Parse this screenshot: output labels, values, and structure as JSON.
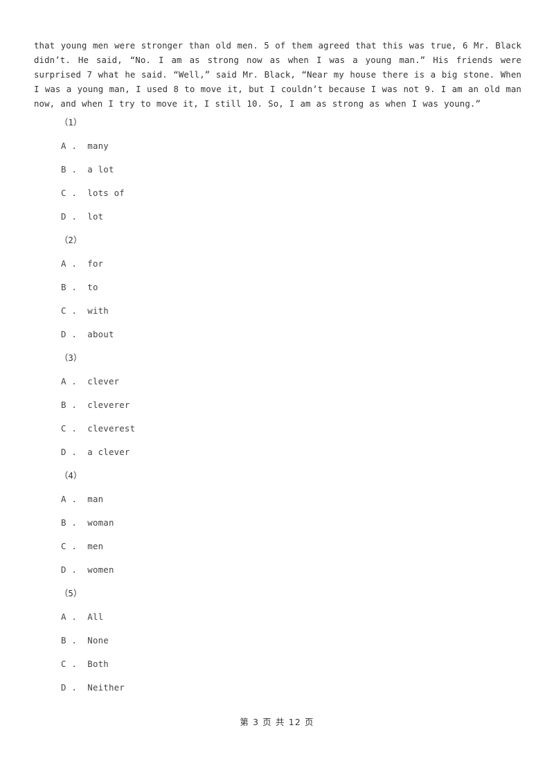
{
  "document": {
    "passage_text": "that young men were stronger than old men. 5 of them agreed that this was true, 6 Mr. Black didn’t. He said, “No. I am as strong now as when I was a young man.” His friends were surprised 7 what he said. “Well,” said Mr. Black, “Near my house there is a big stone. When I was a young man, I used 8 to move it, but I couldn’t because I was not 9. I am an old man now, and when I try to move it, I still 10. So, I am as strong as when I was young.”",
    "questions": [
      {
        "number": "（1）",
        "options": [
          "A .  many",
          "B .  a lot",
          "C .  lots of",
          "D .  lot"
        ]
      },
      {
        "number": "（2）",
        "options": [
          "A .  for",
          "B .  to",
          "C .  with",
          "D .  about"
        ]
      },
      {
        "number": "（3）",
        "options": [
          "A .  clever",
          "B .  cleverer",
          "C .  cleverest",
          "D .  a clever"
        ]
      },
      {
        "number": "（4）",
        "options": [
          "A .  man",
          "B .  woman",
          "C .  men",
          "D .  women"
        ]
      },
      {
        "number": "（5）",
        "options": [
          "A .  All",
          "B .  None",
          "C .  Both",
          "D .  Neither"
        ]
      }
    ],
    "footer": "第 3 页 共 12 页",
    "page_number": 3,
    "total_pages": 12,
    "colors": {
      "background": "#ffffff",
      "body_text": "#333333",
      "option_text": "#444444"
    }
  }
}
